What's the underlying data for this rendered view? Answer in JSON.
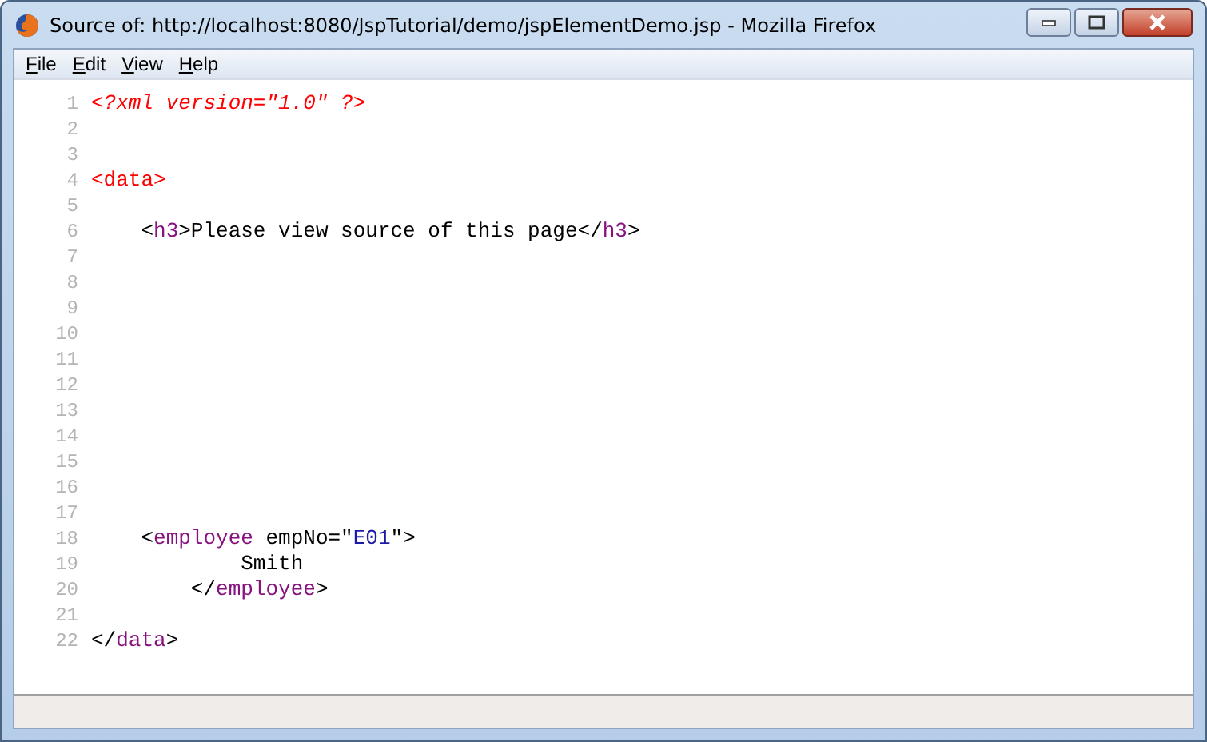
{
  "window": {
    "title": "Source of: http://localhost:8080/JspTutorial/demo/jspElementDemo.jsp - Mozilla Firefox"
  },
  "menu": [
    {
      "label": "File"
    },
    {
      "label": "Edit"
    },
    {
      "label": "View"
    },
    {
      "label": "Help"
    }
  ],
  "source_lines": [
    {
      "number": "1",
      "tokens": [
        {
          "kind": "pi",
          "text": "<?xml version=\"1.0\" ?>"
        }
      ]
    },
    {
      "number": "2"
    },
    {
      "number": "3"
    },
    {
      "number": "4",
      "tokens": [
        {
          "kind": "error",
          "text": "<data>"
        }
      ]
    },
    {
      "number": "5"
    },
    {
      "number": "6",
      "tokens": [
        {
          "kind": "plain",
          "text": "    <"
        },
        {
          "kind": "name",
          "text": "h3"
        },
        {
          "kind": "plain",
          "text": ">Please view source of this page</"
        },
        {
          "kind": "name",
          "text": "h3"
        },
        {
          "kind": "plain",
          "text": ">"
        }
      ]
    },
    {
      "number": "7"
    },
    {
      "number": "8"
    },
    {
      "number": "9"
    },
    {
      "number": "10"
    },
    {
      "number": "11"
    },
    {
      "number": "12"
    },
    {
      "number": "13"
    },
    {
      "number": "14"
    },
    {
      "number": "15"
    },
    {
      "number": "16"
    },
    {
      "number": "17"
    },
    {
      "number": "18",
      "tokens": [
        {
          "kind": "plain",
          "text": "    <"
        },
        {
          "kind": "name",
          "text": "employee"
        },
        {
          "kind": "plain",
          "text": " empNo=\""
        },
        {
          "kind": "value",
          "text": "E01"
        },
        {
          "kind": "plain",
          "text": "\">"
        }
      ]
    },
    {
      "number": "19",
      "tokens": [
        {
          "kind": "plain",
          "text": "            Smith"
        }
      ]
    },
    {
      "number": "20",
      "tokens": [
        {
          "kind": "plain",
          "text": "        </"
        },
        {
          "kind": "name",
          "text": "employee"
        },
        {
          "kind": "plain",
          "text": ">"
        }
      ]
    },
    {
      "number": "21"
    },
    {
      "number": "22",
      "tokens": [
        {
          "kind": "plain",
          "text": "</"
        },
        {
          "kind": "name",
          "text": "data"
        },
        {
          "kind": "plain",
          "text": ">"
        }
      ]
    }
  ]
}
